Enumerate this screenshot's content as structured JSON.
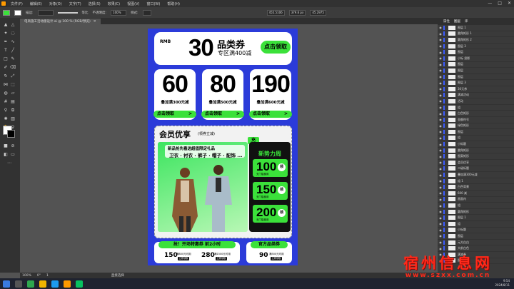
{
  "menubar": {
    "items": [
      "文件(F)",
      "编辑(E)",
      "对象(O)",
      "文字(T)",
      "选择(S)",
      "效果(C)",
      "视图(V)",
      "窗口(W)",
      "帮助(H)"
    ],
    "window_controls": [
      "—",
      "□",
      "✕"
    ]
  },
  "controlbar": {
    "stroke_label": "描边:",
    "uniform_label": "等比",
    "opacity_label": "不透明度:",
    "opacity_value": "100%",
    "style_label": "样式:",
    "x_value": "455.5106",
    "w_value": "379.6 px",
    "h_value": "45.2975"
  },
  "document_tab": {
    "title": "电商施工活动版设计.ai @ 100 % (RGB/预览)",
    "close": "✕"
  },
  "statusbar": {
    "zoom": "100%",
    "rotate": "0°",
    "page": "1",
    "tool": "直接选择"
  },
  "panel": {
    "tabs": [
      "属性",
      "图层",
      "库"
    ],
    "layers": [
      "图层 1",
      "圆角矩形 1",
      "圆角矩形 2",
      "图层 3",
      "图层",
      "小标 投影",
      "图层",
      "图层",
      "图层",
      "图层 3",
      "30元券",
      "满减活动",
      "活动",
      "组",
      "白色矩形",
      "金额符号",
      "绿色矩形",
      "图层",
      "组",
      "小标题",
      "圆角矩形",
      "图案矩形",
      "会员优享",
      "二级标题",
      "叠加满300元减",
      "组 1",
      "白色背景",
      "600 减",
      "画面内",
      "组",
      "圆角矩形",
      "图层 1",
      "组",
      "小标题",
      "图层",
      "元方白白",
      "大前白色",
      "满减券",
      "图层"
    ]
  },
  "artboard": {
    "top": {
      "rmb": "RMB",
      "amount": "30",
      "title": "品类券",
      "subtitle": "专区满400减",
      "button": "点击领取"
    },
    "coupons": [
      {
        "value": "60",
        "desc": "叠加满300元减",
        "button": "点击领取",
        "arrow": ">"
      },
      {
        "value": "80",
        "desc": "叠加满500元减",
        "button": "点击领取",
        "arrow": ">"
      },
      {
        "value": "190",
        "desc": "叠加满600元减",
        "button": "点击领取",
        "arrow": ">"
      }
    ],
    "vip": {
      "title": "会员优享",
      "subtitle": "(领券立减)",
      "promo_line1": "新品抢先看送超值限定礼品",
      "promo_line2": "卫衣 · 衬衣 · 裤子 · 帽子 · 配饰 ...",
      "badge": "充",
      "panel_title": "新势力周",
      "coupons": [
        {
          "value": "100",
          "claim": "领",
          "sub": "无门槛使用"
        },
        {
          "value": "150",
          "claim": "领",
          "sub": "无门槛使用"
        },
        {
          "value": "200",
          "claim": "领",
          "sub": "无门槛使用"
        }
      ]
    },
    "bottom_left": {
      "pill": "抢！开场特惠券 前2小时",
      "items": [
        {
          "value": "150",
          "sub": "满800元可用",
          "tag": "立即领取"
        },
        {
          "value": "280",
          "sub": "满1500元可用",
          "tag": "立即领取"
        }
      ]
    },
    "bottom_right": {
      "pill": "官方品类券",
      "items": [
        {
          "value": "90",
          "sub": "满500元可用",
          "tag": "立即领取"
        }
      ]
    }
  },
  "watermark": {
    "name": "宿州信息网",
    "url": "www.szxx.com.cn"
  },
  "clock": {
    "time": "9:54",
    "date": "2024/8/11"
  },
  "colors": {
    "accent_blue": "#2b3bd9",
    "accent_green": "#3be13a",
    "ui_dark": "#323232"
  }
}
